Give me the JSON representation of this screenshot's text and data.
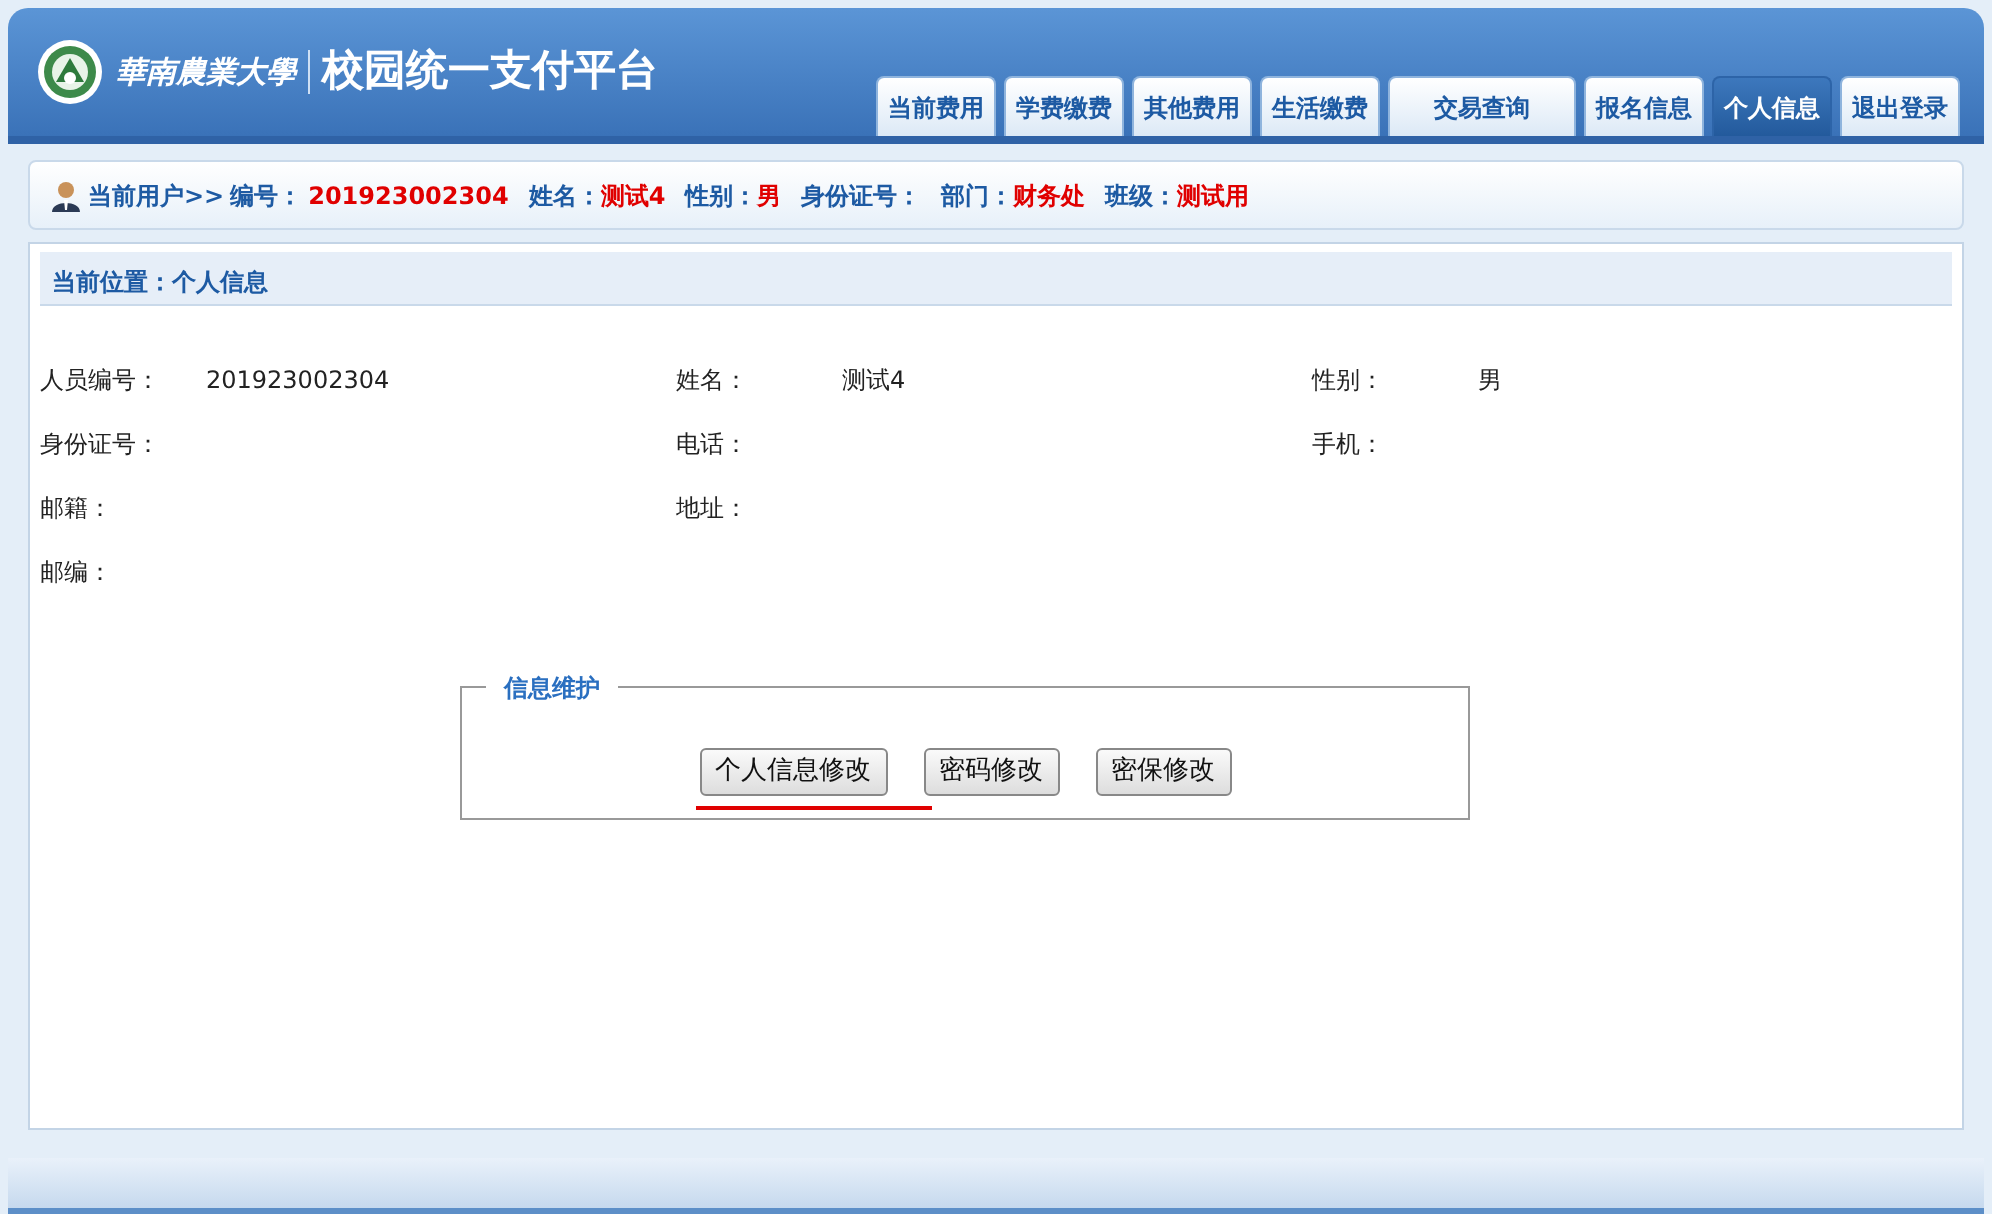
{
  "header": {
    "school_name": "華南農業大學",
    "platform_title": "校园统一支付平台"
  },
  "tabs": [
    {
      "label": "当前费用",
      "selected": false
    },
    {
      "label": "学费缴费",
      "selected": false
    },
    {
      "label": "其他费用",
      "selected": false
    },
    {
      "label": "生活缴费",
      "selected": false
    },
    {
      "label": "交易查询",
      "selected": false
    },
    {
      "label": "报名信息",
      "selected": false
    },
    {
      "label": "个人信息",
      "selected": true
    },
    {
      "label": "退出登录",
      "selected": false
    }
  ],
  "user_bar": {
    "label": "当前用户>>",
    "fields": [
      {
        "label": "编号：",
        "value": "201923002304"
      },
      {
        "label": "姓名：",
        "value": "测试4"
      },
      {
        "label": "性别：",
        "value": "男"
      },
      {
        "label": "身份证号："
      },
      {
        "label": "部门：",
        "value": "财务处"
      },
      {
        "label": "班级：",
        "value": "测试用"
      }
    ]
  },
  "location": "当前位置：个人信息",
  "info_rows": [
    [
      {
        "label": "人员编号：",
        "value": "201923002304"
      },
      {
        "label": "姓名：",
        "value": "测试4"
      },
      {
        "label": "性别：",
        "value": "男"
      }
    ],
    [
      {
        "label": "身份证号："
      },
      {
        "label": "电话："
      },
      {
        "label": "手机："
      }
    ],
    [
      {
        "label": "邮籍："
      },
      {
        "label": "地址："
      }
    ],
    [
      {
        "label": "邮编："
      }
    ]
  ],
  "maintenance": {
    "legend": "信息维护",
    "buttons": [
      {
        "label": "个人信息修改",
        "underlined": true
      },
      {
        "label": "密码修改",
        "underlined": false
      },
      {
        "label": "密保修改",
        "underlined": false
      }
    ]
  }
}
